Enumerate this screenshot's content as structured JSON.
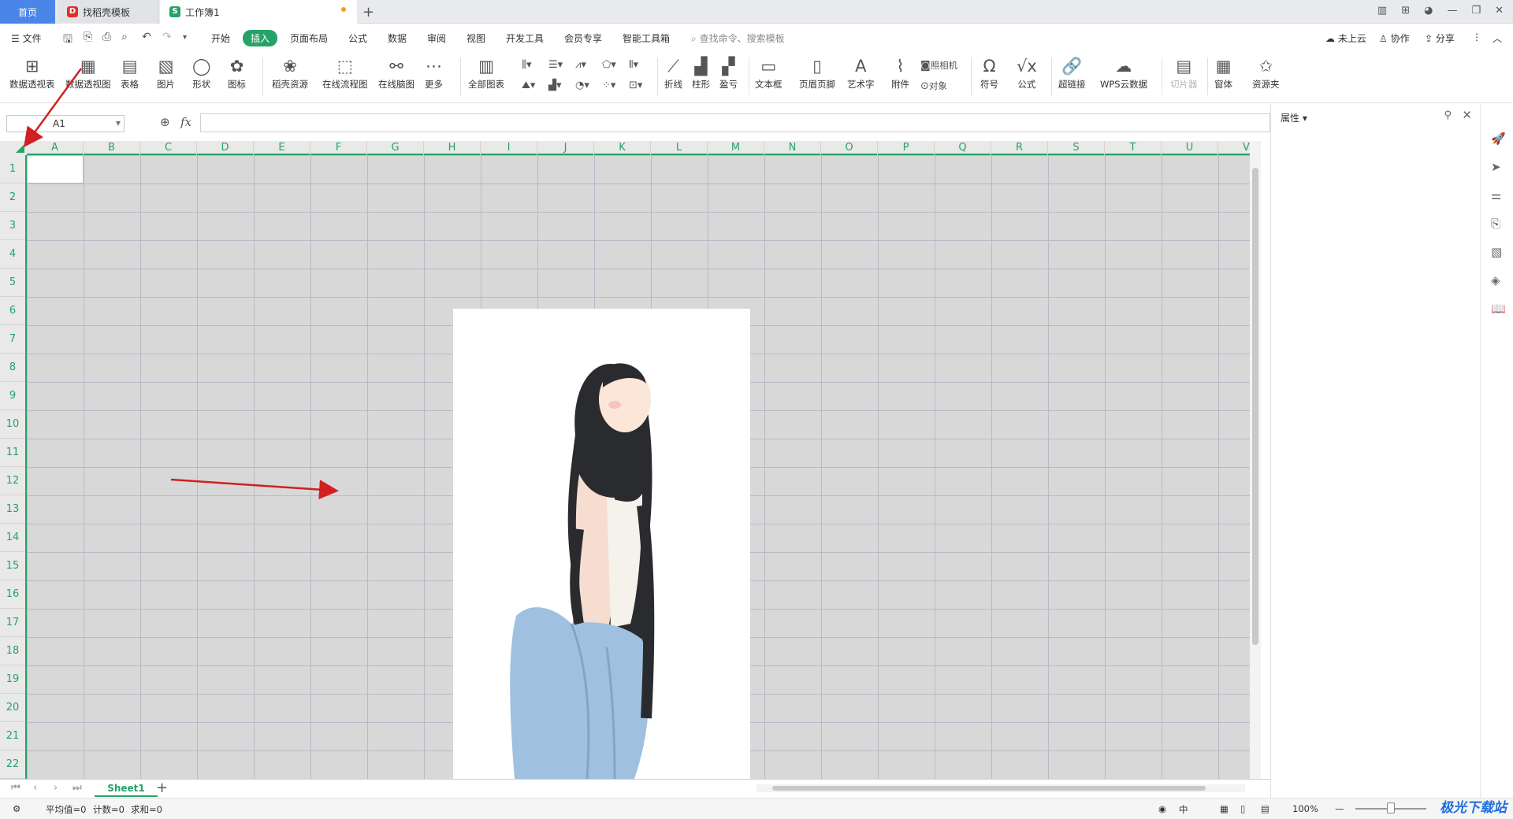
{
  "tabs": {
    "home": "首页",
    "template": "找稻壳模板",
    "workbook": "工作簿1",
    "new_tab": "+"
  },
  "menu": {
    "file": "文件",
    "items": [
      "开始",
      "插入",
      "页面布局",
      "公式",
      "数据",
      "审阅",
      "视图",
      "开发工具",
      "会员专享",
      "智能工具箱"
    ],
    "active_index": 1,
    "search": "查找命令、搜索模板",
    "right": [
      "未上云",
      "协作",
      "分享"
    ]
  },
  "ribbon": {
    "buttons": [
      "数据透视表",
      "数据透视图",
      "表格",
      "图片",
      "形状",
      "图标",
      "稻壳资源",
      "在线流程图",
      "在线脑图",
      "更多",
      "全部图表",
      "折线",
      "柱形",
      "盈亏",
      "文本框",
      "页眉页脚",
      "艺术字",
      "附件",
      "符号",
      "公式",
      "超链接",
      "WPS云数据",
      "切片器",
      "窗体",
      "资源夹"
    ],
    "small": [
      "照相机",
      "对象"
    ],
    "disabled": "切片器"
  },
  "formula_bar": {
    "name_box": "A1",
    "fx": "fx",
    "value": ""
  },
  "grid": {
    "columns": [
      "A",
      "B",
      "C",
      "D",
      "E",
      "F",
      "G",
      "H",
      "I",
      "J",
      "K",
      "L",
      "M",
      "N",
      "O",
      "P",
      "Q",
      "R",
      "S",
      "T",
      "U",
      "V"
    ],
    "rows": [
      "1",
      "2",
      "3",
      "4",
      "5",
      "6",
      "7",
      "8",
      "9",
      "10",
      "11",
      "12",
      "13",
      "14",
      "15",
      "16",
      "17",
      "18",
      "19",
      "20",
      "21",
      "22"
    ],
    "selected_cell": "A1"
  },
  "sheets": {
    "tabs": [
      "Sheet1"
    ],
    "active": "Sheet1"
  },
  "status": {
    "average": "平均值=0",
    "count": "计数=0",
    "sum": "求和=0",
    "zoom": "100%",
    "ime": "中"
  },
  "properties_panel": {
    "title": "属性"
  },
  "watermark": "极光下载站",
  "colors": {
    "accent": "#26a269",
    "selected_tab": "#4a86e8",
    "arrow": "#d0201f",
    "grid_bg": "#d8d8d8"
  }
}
